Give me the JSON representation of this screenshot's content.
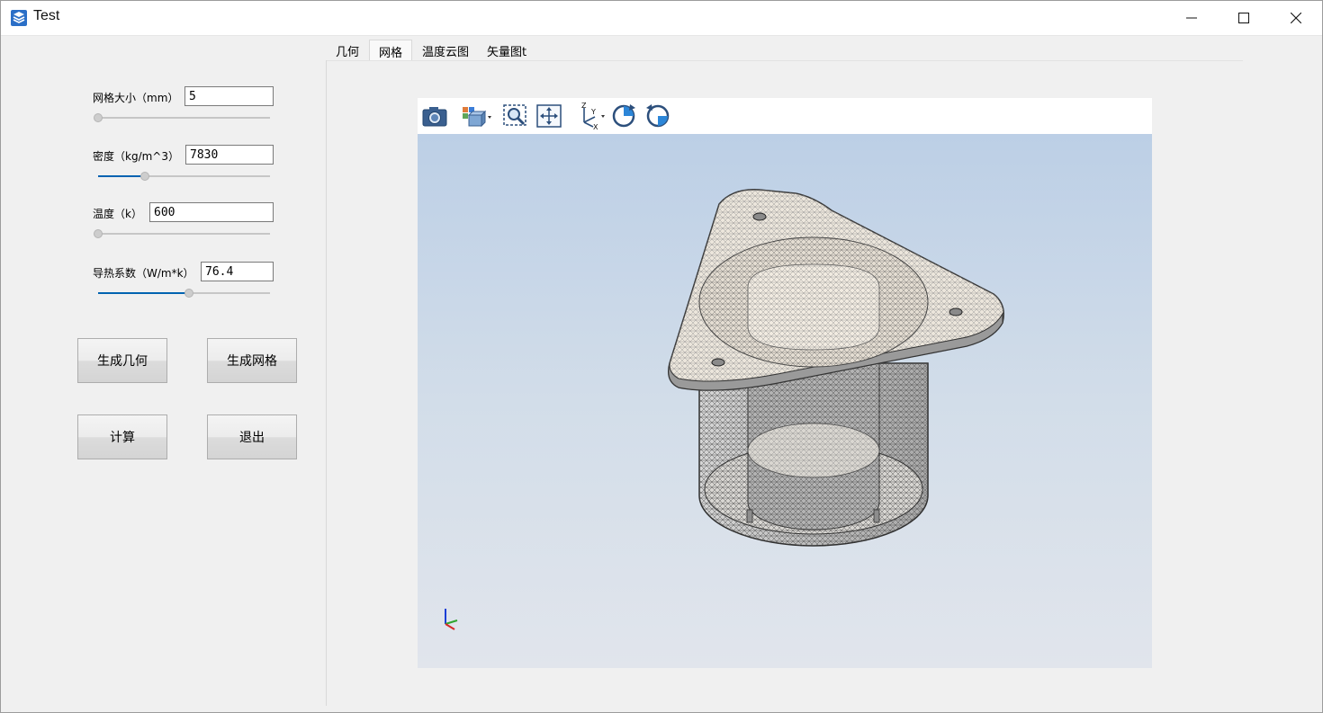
{
  "window": {
    "title": "Test",
    "controls": [
      "minimize-icon",
      "maximize-icon",
      "close-icon"
    ]
  },
  "params": [
    {
      "label": "网格大小（mm）",
      "value": "5",
      "slider_fraction": 0.0
    },
    {
      "label": "密度（kg/m^3）",
      "value": "7830",
      "slider_fraction": 0.27
    },
    {
      "label": "温度（k）",
      "value": "600",
      "slider_fraction": 0.0
    },
    {
      "label": "导热系数（W/m*k）",
      "value": "76.4",
      "slider_fraction": 0.53
    }
  ],
  "buttons": {
    "gen_geometry": "生成几何",
    "gen_mesh": "生成网格",
    "compute": "计算",
    "exit": "退出"
  },
  "tabs": [
    {
      "label": "几何",
      "active": false
    },
    {
      "label": "网格",
      "active": true
    },
    {
      "label": "温度云图",
      "active": false
    },
    {
      "label": "矢量图t",
      "active": false
    }
  ],
  "toolbar": {
    "tools": [
      "camera-icon",
      "view-mode-icon",
      "zoom-box-icon",
      "fit-view-icon",
      "axes-orientation-icon",
      "rotate-cw-icon",
      "rotate-ccw-icon"
    ]
  },
  "viewport": {
    "model": "meshed-part-icon",
    "triad": "axis-triad-icon",
    "colors": {
      "background_top": "#bccfe6",
      "background_bottom": "#e1e5ec",
      "accent": "#0063b1"
    }
  }
}
